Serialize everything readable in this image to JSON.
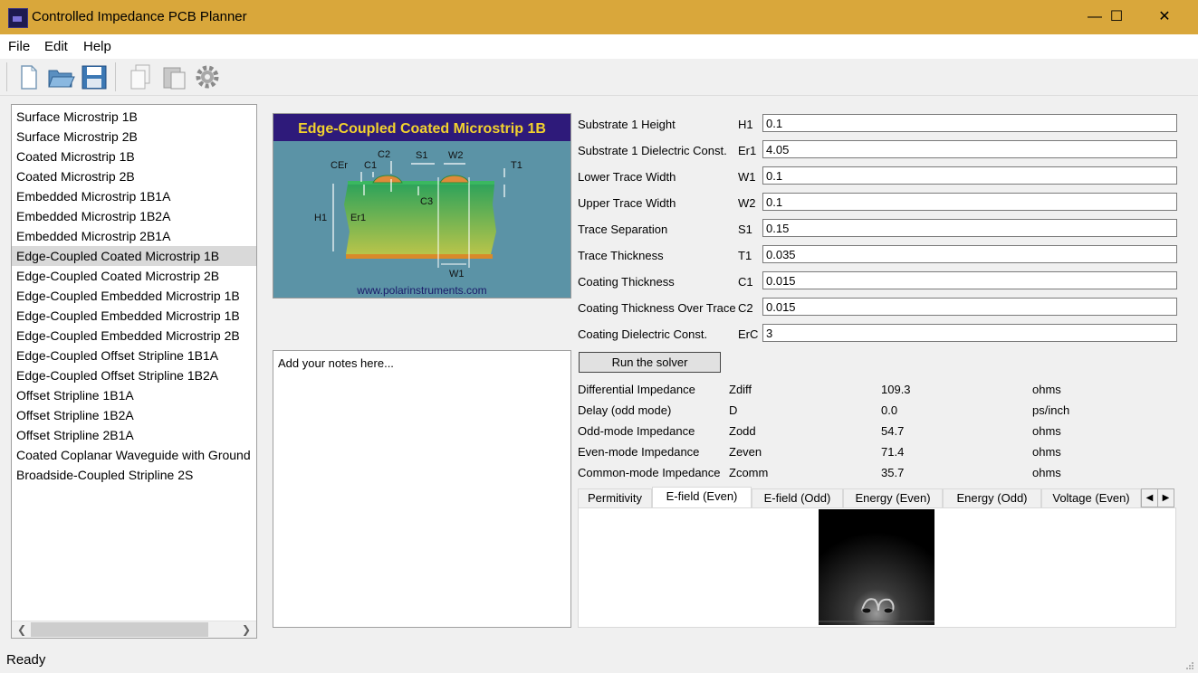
{
  "window": {
    "title": "Controlled Impedance PCB Planner",
    "minimize": "—",
    "maximize": "☐",
    "close": "✕"
  },
  "menu": {
    "file": "File",
    "edit": "Edit",
    "help": "Help"
  },
  "structures": [
    "Surface Microstrip 1B",
    "Surface Microstrip 2B",
    "Coated Microstrip 1B",
    "Coated Microstrip 2B",
    "Embedded Microstrip 1B1A",
    "Embedded Microstrip 1B2A",
    "Embedded Microstrip 2B1A",
    "Edge-Coupled Coated Microstrip 1B",
    "Edge-Coupled Coated Microstrip 2B",
    "Edge-Coupled Embedded Microstrip 1B",
    "Edge-Coupled Embedded Microstrip 1B",
    "Edge-Coupled Embedded Microstrip 2B",
    "Edge-Coupled Offset Stripline 1B1A",
    "Edge-Coupled Offset Stripline 1B2A",
    "Offset Stripline 1B1A",
    "Offset Stripline 1B2A",
    "Offset Stripline 2B1A",
    "Coated Coplanar Waveguide with Ground",
    "Broadside-Coupled Stripline 2S"
  ],
  "selected_structure": "Edge-Coupled Coated Microstrip 1B",
  "diagram": {
    "title": "Edge-Coupled Coated Microstrip 1B",
    "website": "www.polarinstruments.com",
    "labels": {
      "cer": "CEr",
      "c1": "C1",
      "c2": "C2",
      "s1": "S1",
      "w2": "W2",
      "t1": "T1",
      "c3": "C3",
      "h1": "H1",
      "er1": "Er1",
      "w1": "W1"
    }
  },
  "notes_placeholder": "Add your notes here...",
  "params": [
    {
      "label": "Substrate 1 Height",
      "symbol": "H1",
      "value": "0.1"
    },
    {
      "label": "Substrate 1 Dielectric Const.",
      "symbol": "Er1",
      "value": "4.05"
    },
    {
      "label": "Lower Trace Width",
      "symbol": "W1",
      "value": "0.1"
    },
    {
      "label": "Upper Trace Width",
      "symbol": "W2",
      "value": "0.1"
    },
    {
      "label": "Trace Separation",
      "symbol": "S1",
      "value": "0.15"
    },
    {
      "label": "Trace Thickness",
      "symbol": "T1",
      "value": "0.035"
    },
    {
      "label": "Coating Thickness",
      "symbol": "C1",
      "value": "0.015"
    },
    {
      "label": "Coating Thickness Over Trace",
      "symbol": "C2",
      "value": "0.015"
    },
    {
      "label": "Coating Dielectric Const.",
      "symbol": "ErC",
      "value": "3"
    }
  ],
  "run_button": "Run the solver",
  "results": [
    {
      "label": "Differential Impedance",
      "symbol": "Zdiff",
      "value": "109.3",
      "unit": "ohms"
    },
    {
      "label": "Delay (odd mode)",
      "symbol": "D",
      "value": "0.0",
      "unit": "ps/inch"
    },
    {
      "label": "Odd-mode Impedance",
      "symbol": "Zodd",
      "value": "54.7",
      "unit": "ohms"
    },
    {
      "label": "Even-mode Impedance",
      "symbol": "Zeven",
      "value": "71.4",
      "unit": "ohms"
    },
    {
      "label": "Common-mode Impedance",
      "symbol": "Zcomm",
      "value": "35.7",
      "unit": "ohms"
    }
  ],
  "tabs": [
    "Permitivity",
    "E-field (Even)",
    "E-field (Odd)",
    "Energy (Even)",
    "Energy (Odd)",
    "Voltage (Even)"
  ],
  "active_tab": "E-field (Even)",
  "status": "Ready",
  "colors": {
    "titlebar": "#d9a73b",
    "diagram_bg": "#5b93a6",
    "diagram_title_bg": "#2e1a7a",
    "diagram_title_text": "#f2d22e"
  }
}
